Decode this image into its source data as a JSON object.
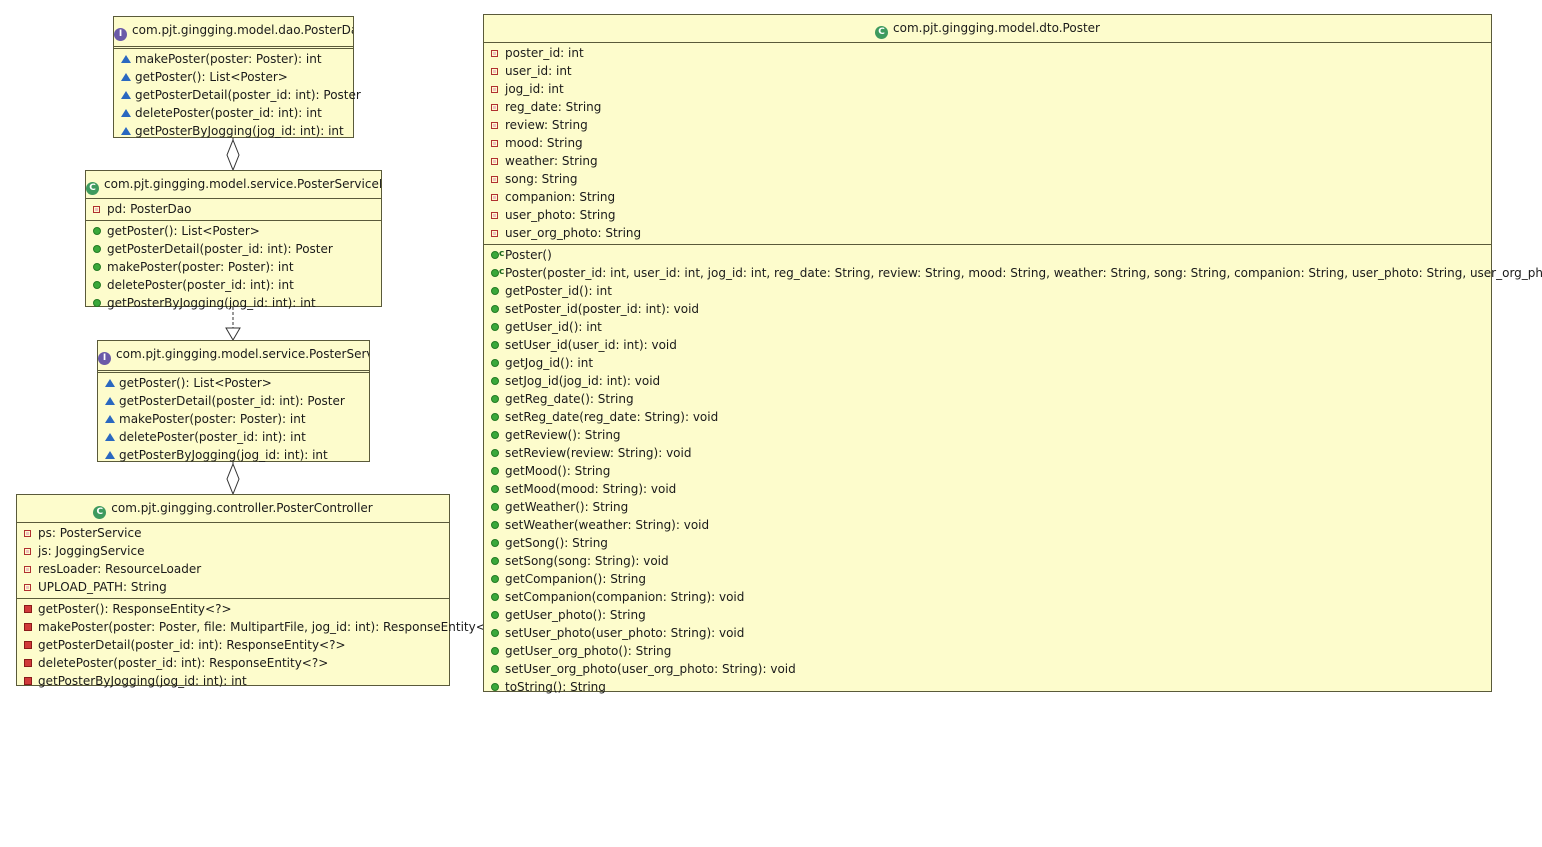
{
  "classes": {
    "poster_dao": {
      "name": "com.pjt.gingging.model.dao.PosterDao",
      "kind": "interface",
      "methods": [
        "makePoster(poster: Poster): int",
        "getPoster(): List<Poster>",
        "getPosterDetail(poster_id: int): Poster",
        "deletePoster(poster_id: int): int",
        "getPosterByJogging(jog_id: int): int"
      ]
    },
    "poster_service_impl": {
      "name": "com.pjt.gingging.model.service.PosterServiceImpl",
      "kind": "class",
      "fields": [
        "pd: PosterDao"
      ],
      "methods": [
        "getPoster(): List<Poster>",
        "getPosterDetail(poster_id: int): Poster",
        "makePoster(poster: Poster): int",
        "deletePoster(poster_id: int): int",
        "getPosterByJogging(jog_id: int): int"
      ]
    },
    "poster_service": {
      "name": "com.pjt.gingging.model.service.PosterService",
      "kind": "interface",
      "methods": [
        "getPoster(): List<Poster>",
        "getPosterDetail(poster_id: int): Poster",
        "makePoster(poster: Poster): int",
        "deletePoster(poster_id: int): int",
        "getPosterByJogging(jog_id: int): int"
      ]
    },
    "poster_controller": {
      "name": "com.pjt.gingging.controller.PosterController",
      "kind": "class",
      "fields": [
        "ps: PosterService",
        "js: JoggingService",
        "resLoader: ResourceLoader",
        "UPLOAD_PATH: String"
      ],
      "methods": [
        "getPoster(): ResponseEntity<?>",
        "makePoster(poster: Poster, file: MultipartFile, jog_id: int): ResponseEntity<?>",
        "getPosterDetail(poster_id: int): ResponseEntity<?>",
        "deletePoster(poster_id: int): ResponseEntity<?>",
        "getPosterByJogging(jog_id: int): int"
      ]
    },
    "poster_dto": {
      "name": "com.pjt.gingging.model.dto.Poster",
      "kind": "class",
      "fields": [
        "poster_id: int",
        "user_id: int",
        "jog_id: int",
        "reg_date: String",
        "review: String",
        "mood: String",
        "weather: String",
        "song: String",
        "companion: String",
        "user_photo: String",
        "user_org_photo: String"
      ],
      "constructors": [
        "Poster()",
        "Poster(poster_id: int, user_id: int, jog_id: int, reg_date: String, review: String, mood: String, weather: String, song: String, companion: String, user_photo: String, user_org_photo: String)"
      ],
      "methods": [
        "getPoster_id(): int",
        "setPoster_id(poster_id: int): void",
        "getUser_id(): int",
        "setUser_id(user_id: int): void",
        "getJog_id(): int",
        "setJog_id(jog_id: int): void",
        "getReg_date(): String",
        "setReg_date(reg_date: String): void",
        "getReview(): String",
        "setReview(review: String): void",
        "getMood(): String",
        "setMood(mood: String): void",
        "getWeather(): String",
        "setWeather(weather: String): void",
        "getSong(): String",
        "setSong(song: String): void",
        "getCompanion(): String",
        "setCompanion(companion: String): void",
        "getUser_photo(): String",
        "setUser_photo(user_photo: String): void",
        "getUser_org_photo(): String",
        "setUser_org_photo(user_org_photo: String): void",
        "toString(): String"
      ]
    }
  },
  "colors": {
    "box_fill": "#fdfccc",
    "border": "#5a5a3a",
    "public": "#3aa83a",
    "private": "#d03a3a",
    "package": "#2a68c0"
  },
  "icons": {
    "class": "class-icon",
    "interface": "interface-icon",
    "field": "private-field-icon",
    "public_method": "public-method-icon",
    "abstract_method": "abstract-method-icon",
    "private_method": "private-method-icon",
    "constructor": "constructor-icon"
  }
}
